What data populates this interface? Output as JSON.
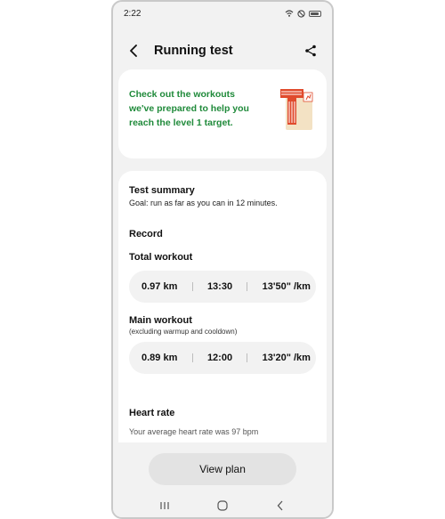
{
  "status_bar": {
    "time": "2:22"
  },
  "header": {
    "title": "Running test"
  },
  "promo": {
    "text": "Check out the workouts we've prepared to help you reach the level 1 target."
  },
  "summary": {
    "title": "Test summary",
    "goal": "Goal: run as far as you can in 12 minutes.",
    "record_label": "Record",
    "total": {
      "label": "Total workout",
      "distance": "0.97 km",
      "time": "13:30",
      "pace": "13'50\" /km"
    },
    "main": {
      "label": "Main workout",
      "note": "(excluding warmup and cooldown)",
      "distance": "0.89 km",
      "time": "12:00",
      "pace": "13'20\" /km"
    },
    "heart_rate_label": "Heart rate",
    "heart_rate_text_partial": "Your average heart rate was 97 bpm"
  },
  "footer": {
    "button_label": "View plan"
  },
  "icons": [
    "back-icon",
    "share-icon",
    "wifi-icon",
    "do-not-disturb-icon",
    "battery-icon",
    "recents-icon",
    "home-icon",
    "back-nav-icon"
  ],
  "colors": {
    "accent_green": "#1f8a3a",
    "background": "#f2f2f2"
  }
}
